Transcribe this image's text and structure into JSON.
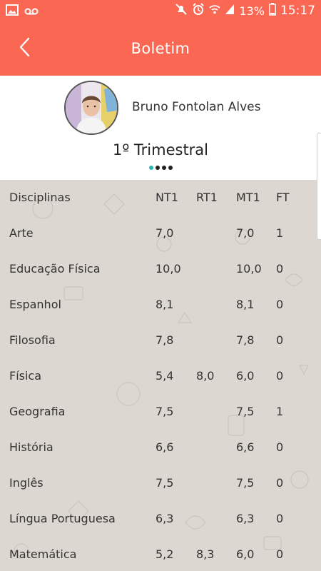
{
  "status_bar": {
    "time": "15:17",
    "battery": "13%",
    "icons": [
      "image-icon",
      "voicemail-icon",
      "mute-icon",
      "alarm-icon",
      "wifi-icon",
      "signal-icon",
      "battery-icon"
    ]
  },
  "header": {
    "title": "Boletim",
    "back_icon": "chevron-left-icon"
  },
  "student": {
    "name": "Bruno Fontolan Alves"
  },
  "period": {
    "title": "1º Trimestral",
    "page_count": 4,
    "active_page": 1
  },
  "grades": {
    "headers": [
      "Disciplinas",
      "NT1",
      "RT1",
      "MT1",
      "FT"
    ],
    "rows": [
      {
        "subject": "Arte",
        "nt1": "7,0",
        "rt1": "",
        "mt1": "7,0",
        "ft": "1"
      },
      {
        "subject": "Educação Física",
        "nt1": "10,0",
        "rt1": "",
        "mt1": "10,0",
        "ft": "0"
      },
      {
        "subject": "Espanhol",
        "nt1": "8,1",
        "rt1": "",
        "mt1": "8,1",
        "ft": "0"
      },
      {
        "subject": "Filosofia",
        "nt1": "7,8",
        "rt1": "",
        "mt1": "7,8",
        "ft": "0"
      },
      {
        "subject": "Física",
        "nt1": "5,4",
        "rt1": "8,0",
        "mt1": "6,0",
        "ft": "0"
      },
      {
        "subject": "Geografia",
        "nt1": "7,5",
        "rt1": "",
        "mt1": "7,5",
        "ft": "1"
      },
      {
        "subject": "História",
        "nt1": "6,6",
        "rt1": "",
        "mt1": "6,6",
        "ft": "0"
      },
      {
        "subject": "Inglês",
        "nt1": "7,5",
        "rt1": "",
        "mt1": "7,5",
        "ft": "0"
      },
      {
        "subject": "Língua Portuguesa",
        "nt1": "6,3",
        "rt1": "",
        "mt1": "6,3",
        "ft": "0"
      },
      {
        "subject": "Matemática",
        "nt1": "5,2",
        "rt1": "8,3",
        "mt1": "6,0",
        "ft": "0"
      }
    ]
  },
  "colors": {
    "accent": "#fa6752",
    "page_dot_active": "#2bb5b5",
    "table_background": "#dcd7d0"
  }
}
